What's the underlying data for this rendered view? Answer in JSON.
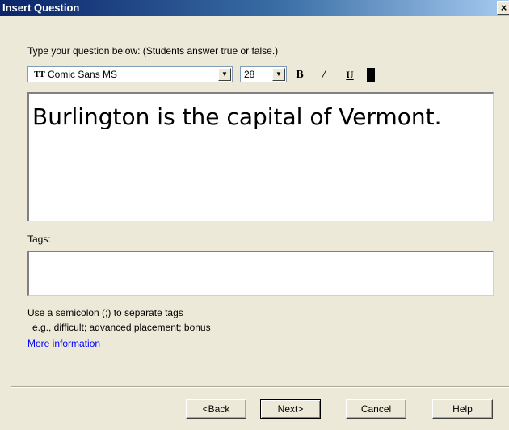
{
  "window": {
    "title": "Insert Question",
    "close_label": "×"
  },
  "prompt": "Type your question below: (Students answer true or false.)",
  "toolbar": {
    "font_icon": "TT",
    "font_value": "Comic Sans MS",
    "size_value": "28",
    "dropdown_glyph": "▼",
    "bold_label": "B",
    "italic_label": "/",
    "underline_label": "U"
  },
  "question": {
    "text": "Burlington is the capital of Vermont."
  },
  "tags": {
    "label": "Tags:",
    "value": ""
  },
  "hints": {
    "line1": "Use a semicolon (;) to separate tags",
    "line2": "e.g., difficult; advanced placement; bonus",
    "more_link": "More information"
  },
  "buttons": {
    "back": "<Back",
    "next": "Next>",
    "cancel": "Cancel",
    "help": "Help"
  },
  "colors": {
    "title_bar_start": "#0a246a",
    "dialog_bg": "#ece9d8",
    "link": "#0000ff",
    "text_color_swatch": "#000000"
  }
}
